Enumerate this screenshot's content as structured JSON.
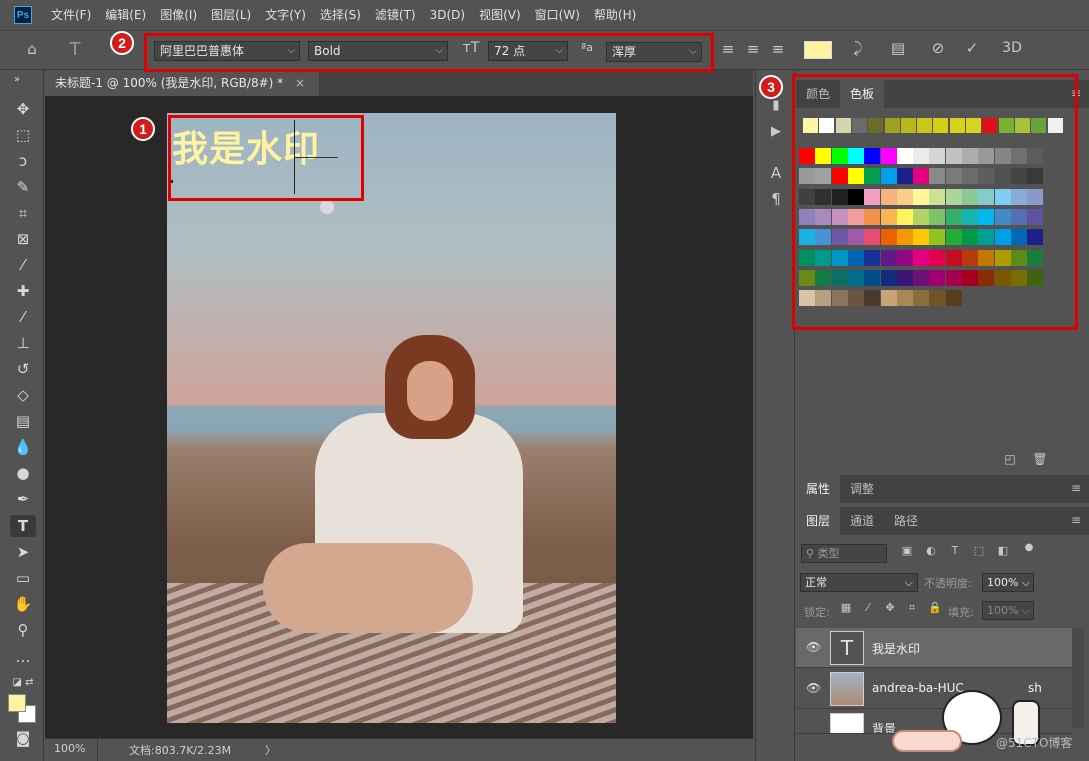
{
  "menu": {
    "logo": "Ps",
    "items": [
      "文件(F)",
      "编辑(E)",
      "图像(I)",
      "图层(L)",
      "文字(Y)",
      "选择(S)",
      "滤镜(T)",
      "3D(D)",
      "视图(V)",
      "窗口(W)",
      "帮助(H)"
    ]
  },
  "options": {
    "font_family": "阿里巴巴普惠体",
    "font_style": "Bold",
    "font_size": "72 点",
    "antialias_label": "ªa",
    "antialias": "浑厚",
    "text_color": "#fdf3a0",
    "three_d": "3D"
  },
  "badges": [
    "1",
    "2",
    "3"
  ],
  "document": {
    "tab_title": "未标题-1 @ 100% (我是水印, RGB/8#) *",
    "close": "×",
    "watermark_text": "我是水印",
    "watermark_color": "#fdf3a0"
  },
  "status": {
    "zoom": "100%",
    "doc_info": "文档:803.7K/2.23M",
    "arrow": "〉"
  },
  "swatch_panel": {
    "tabs": [
      "颜色",
      "色板"
    ],
    "active_tab": "色板",
    "recent": [
      "#fff5a0",
      "#ffffff",
      "#d5d5b0",
      "#6b6b6b",
      "#6b6b2a",
      "#9ea21d",
      "#b6b81c",
      "#c8c81b",
      "#d2cf15",
      "#d6d21a",
      "#d7d320",
      "#e01018",
      "#7cb032",
      "#a9c13a",
      "#6aa33c",
      "#f0f0f0"
    ],
    "grid": [
      [
        "#ff0000",
        "#ffff00",
        "#00ff00",
        "#00ffff",
        "#0000ff",
        "#ff00ff",
        "#ffffff",
        "#ebebeb",
        "#d6d6d6",
        "#c2c2c2",
        "#adadad",
        "#999999",
        "#858585",
        "#707070",
        "#5c5c5c"
      ],
      [
        "#9a9a9a",
        "#a0a0a0",
        "#ff0000",
        "#ffff00",
        "#00a050",
        "#00a0e9",
        "#1d2088",
        "#e4007f",
        "#8a8a8a",
        "#7a7a7a",
        "#6b6b6b",
        "#5e5e5e",
        "#515151",
        "#454545",
        "#393939"
      ],
      [
        "#404040",
        "#303030",
        "#202020",
        "#000000",
        "#f19ec2",
        "#f6b37f",
        "#facd89",
        "#fff799",
        "#cce198",
        "#acd598",
        "#89c997",
        "#84ccc9",
        "#7ecef4",
        "#88abda",
        "#8c97cb"
      ],
      [
        "#8f82bc",
        "#aa89bd",
        "#c490bf",
        "#f29c9f",
        "#f19149",
        "#f8b551",
        "#fff45c",
        "#b3d465",
        "#80c269",
        "#32b16c",
        "#13b5b1",
        "#00b7ee",
        "#448aca",
        "#556fb5",
        "#5f52a0"
      ],
      [
        "#1ab2e5",
        "#4a90d9",
        "#6d59a7",
        "#a05ca8",
        "#e84c72",
        "#eb6100",
        "#f39800",
        "#fcc800",
        "#8fc31f",
        "#22ac38",
        "#009944",
        "#009e96",
        "#00a0e9",
        "#0068b7",
        "#1d2088"
      ],
      [
        "#009060",
        "#009b8e",
        "#0096c8",
        "#0064b4",
        "#173296",
        "#601986",
        "#920783",
        "#e4007f",
        "#e5004f",
        "#c30d23",
        "#b83a0a",
        "#c07a00",
        "#ad9d00",
        "#5b8c16",
        "#197d3e"
      ],
      [
        "#6a8a16",
        "#127c46",
        "#0c6f66",
        "#00708a",
        "#004d8b",
        "#132c7c",
        "#3b1675",
        "#6a1278",
        "#a10070",
        "#a6004c",
        "#a5001e",
        "#8a2c06",
        "#7b5700",
        "#786d00",
        "#3f6410"
      ],
      [
        "#d9c3a5",
        "#b59f80",
        "#8c7560",
        "#6a5543",
        "#4b3a2c",
        "#c7a474",
        "#a88956",
        "#8a6e3c",
        "#70552a",
        "#583f1b"
      ]
    ]
  },
  "properties_panel": {
    "tabs": [
      "属性",
      "调整"
    ]
  },
  "layers_panel": {
    "tabs": [
      "图层",
      "通道",
      "路径"
    ],
    "filter_label": "类型",
    "blend_mode": "正常",
    "opacity_label": "不透明度:",
    "opacity": "100%",
    "lock_label": "锁定:",
    "fill_label": "填充:",
    "fill": "100%",
    "layers": [
      {
        "name": "我是水印",
        "thumb": "T"
      },
      {
        "name": "andrea-ba-HUC",
        "suffix": "sh"
      },
      {
        "name": "背景"
      }
    ]
  },
  "watermark_corner": "@51CTO博客"
}
